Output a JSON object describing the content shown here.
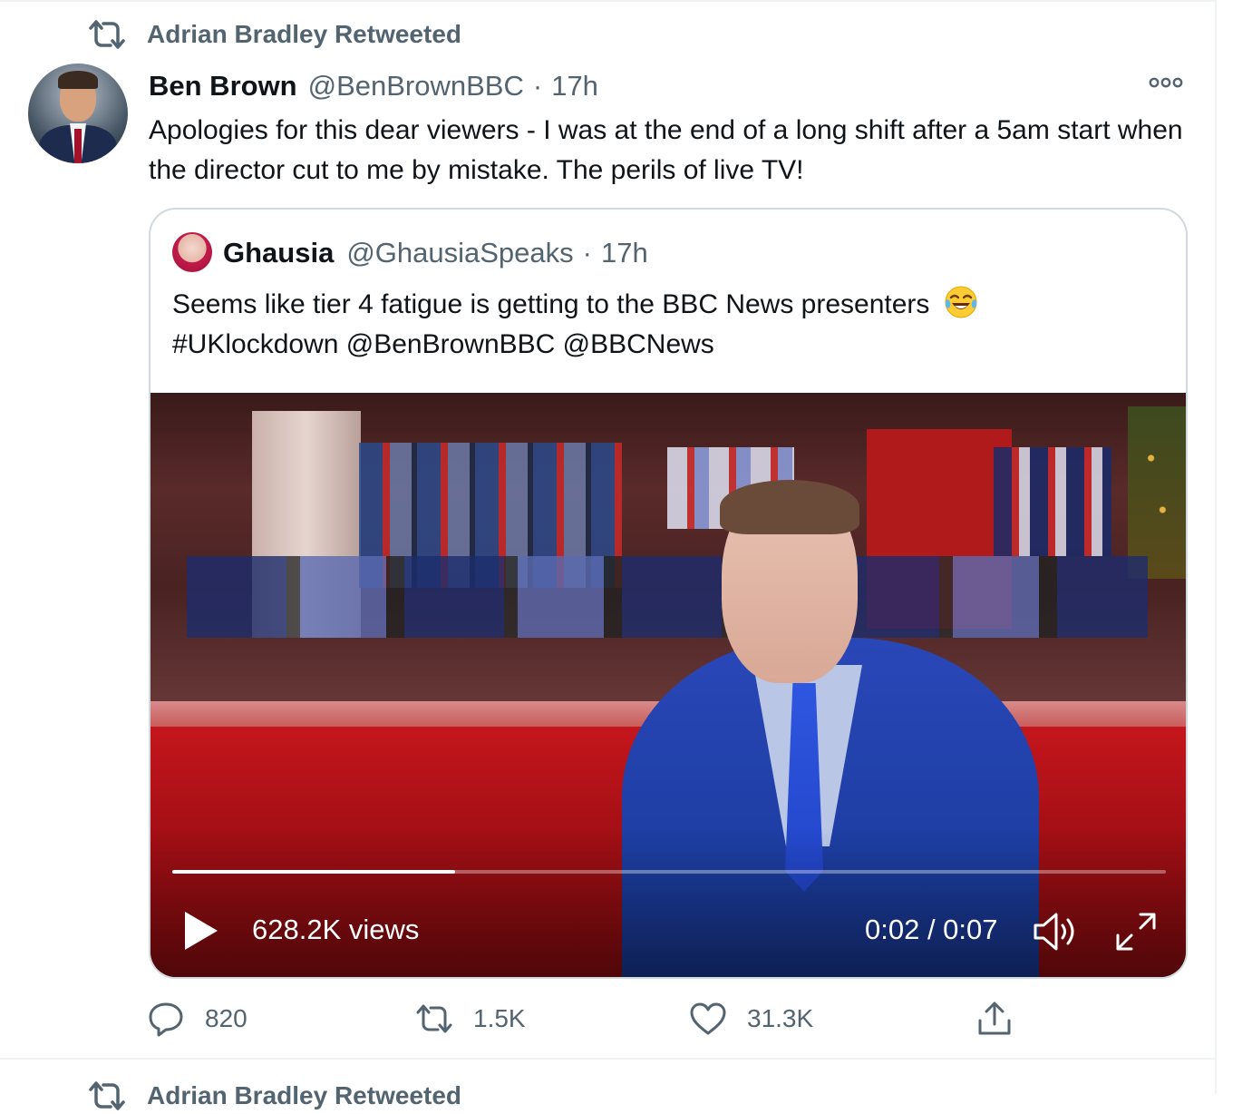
{
  "retweet_context": {
    "icon": "retweet-icon",
    "text": "Adrian Bradley Retweeted"
  },
  "tweet": {
    "author_name": "Ben Brown",
    "author_handle": "@BenBrownBBC",
    "separator": "·",
    "time": "17h",
    "text": "Apologies for this dear viewers - I was at the end of a long shift after a 5am start when the director cut to me by mistake. The perils of live TV!",
    "more_icon": "more-options-icon"
  },
  "quoted_tweet": {
    "author_name": "Ghausia",
    "author_handle": "@GhausiaSpeaks",
    "separator": "·",
    "time": "17h",
    "text_line1": "Seems like tier 4 fatigue is getting to the BBC News presenters",
    "text_emoji": "face-with-tears-of-joy",
    "text_line2": "#UKlockdown @BenBrownBBC @BBCNews"
  },
  "video": {
    "views": "628.2K views",
    "time": "0:02 / 0:07",
    "progress": 0.285,
    "play_icon": "play-icon",
    "volume_icon": "volume-icon",
    "fullscreen_icon": "fullscreen-icon"
  },
  "actions": {
    "reply": {
      "icon": "reply-icon",
      "count": "820"
    },
    "retweet": {
      "icon": "retweet-icon",
      "count": "1.5K"
    },
    "like": {
      "icon": "heart-icon",
      "count": "31.3K"
    },
    "share": {
      "icon": "share-icon"
    }
  },
  "next_retweet_context": {
    "text": "Adrian Bradley Retweeted"
  },
  "colors": {
    "text_primary": "#0f1419",
    "text_secondary": "#536471",
    "border": "#cfd9de",
    "divider": "#eff3f4",
    "bbc_red": "#c4161c",
    "suit_blue": "#1d3ea3"
  }
}
